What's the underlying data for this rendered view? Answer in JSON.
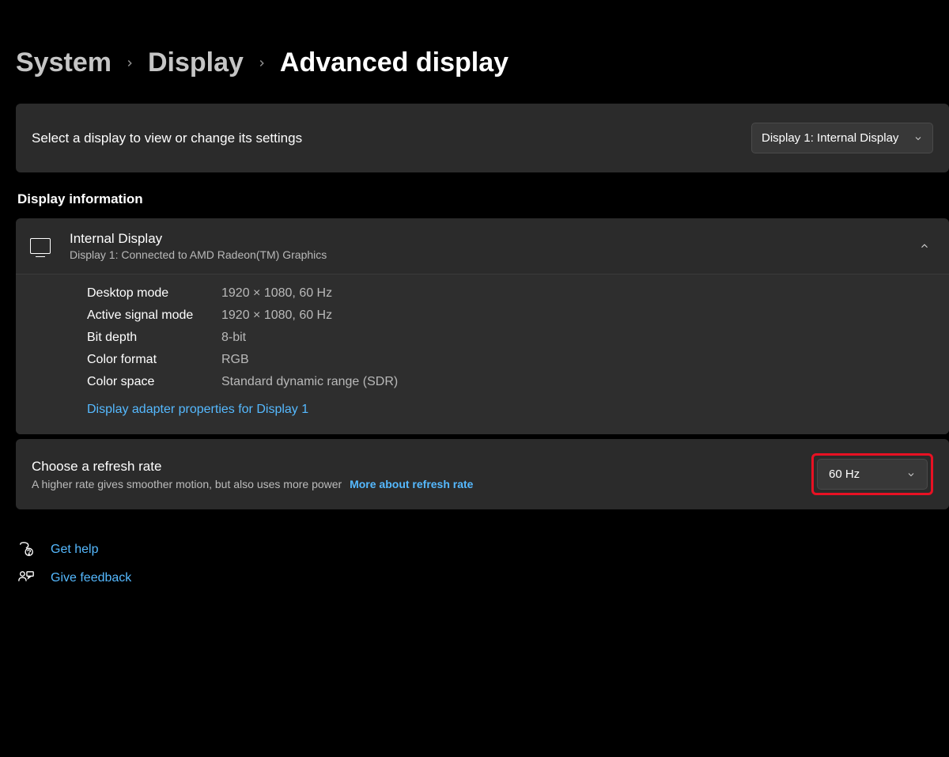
{
  "breadcrumb": {
    "system": "System",
    "display": "Display",
    "current": "Advanced display"
  },
  "select_display": {
    "label": "Select a display to view or change its settings",
    "dropdown_value": "Display 1: Internal Display"
  },
  "section_title": "Display information",
  "display_info": {
    "title": "Internal Display",
    "subtitle": "Display 1: Connected to AMD Radeon(TM) Graphics",
    "rows": [
      {
        "key": "Desktop mode",
        "value": "1920 × 1080, 60 Hz"
      },
      {
        "key": "Active signal mode",
        "value": "1920 × 1080, 60 Hz"
      },
      {
        "key": "Bit depth",
        "value": "8-bit"
      },
      {
        "key": "Color format",
        "value": "RGB"
      },
      {
        "key": "Color space",
        "value": "Standard dynamic range (SDR)"
      }
    ],
    "adapter_link": "Display adapter properties for Display 1"
  },
  "refresh_rate": {
    "title": "Choose a refresh rate",
    "subtitle": "A higher rate gives smoother motion, but also uses more power",
    "more_link": "More about refresh rate",
    "dropdown_value": "60 Hz"
  },
  "footer": {
    "help": "Get help",
    "feedback": "Give feedback"
  }
}
